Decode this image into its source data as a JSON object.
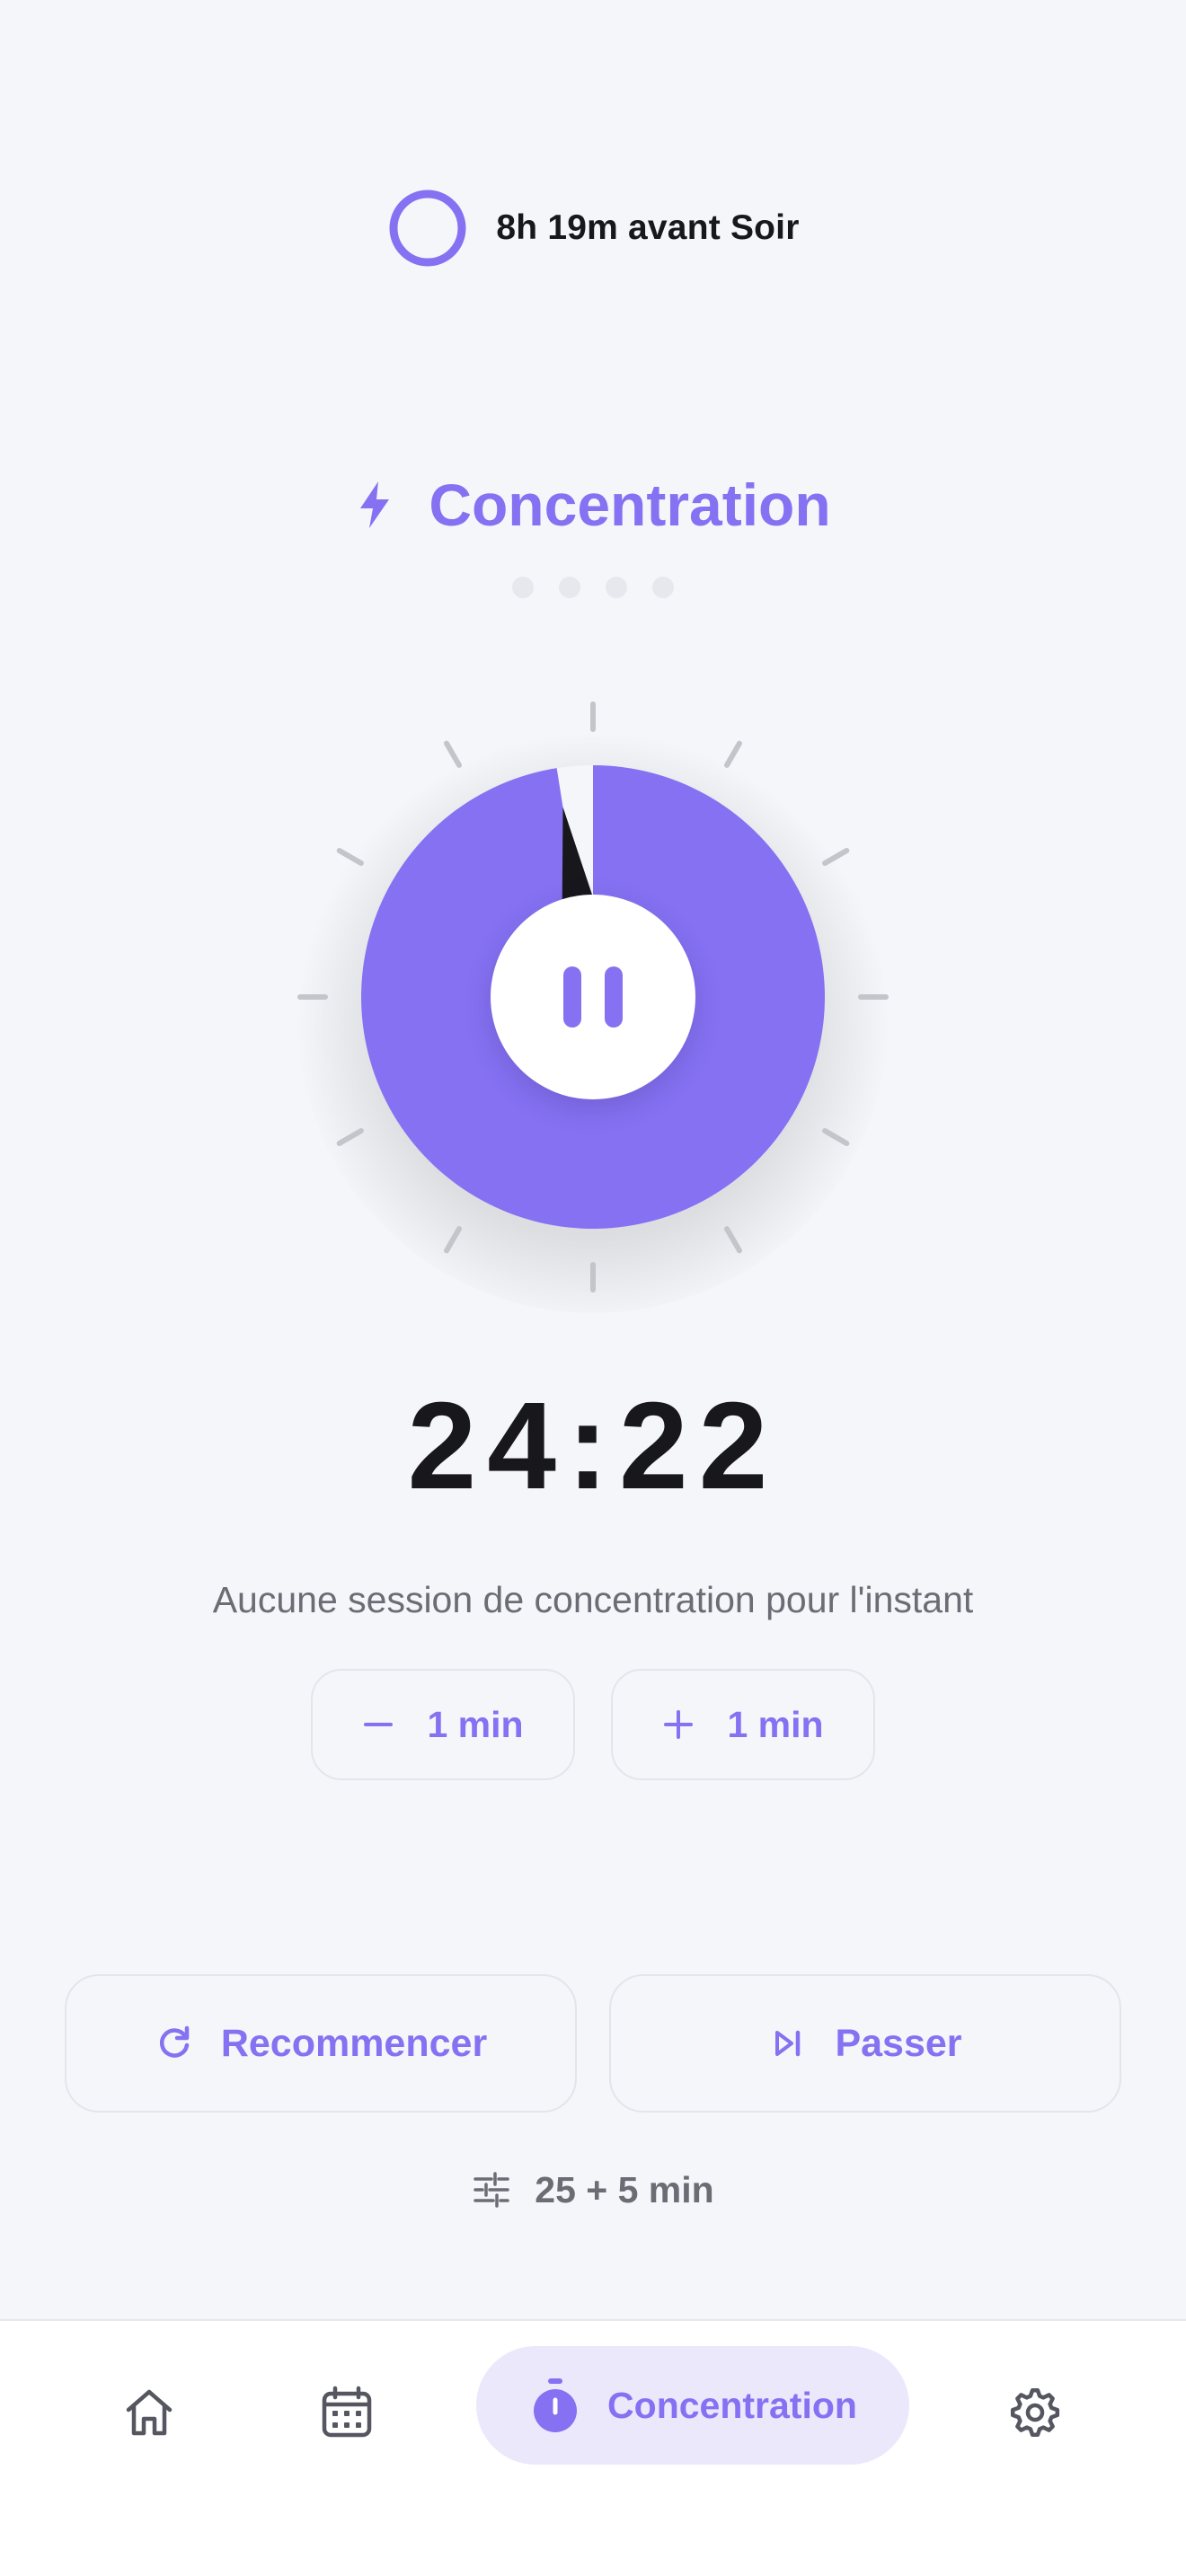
{
  "status": {
    "text": "8h 19m avant Soir"
  },
  "phase": {
    "title": "Concentration",
    "icon": "bolt-icon",
    "session_dots": 4
  },
  "timer": {
    "display": "24:22",
    "progress_fraction": 0.975,
    "controls": {
      "pause_icon": "pause-icon"
    }
  },
  "session": {
    "message": "Aucune session de concentration pour l'instant"
  },
  "adjust": {
    "minus_label": "1 min",
    "plus_label": "1 min"
  },
  "actions": {
    "restart_label": "Recommencer",
    "skip_label": "Passer"
  },
  "preset": {
    "label": "25 + 5 min"
  },
  "nav": {
    "items": [
      {
        "icon": "home-icon",
        "label": ""
      },
      {
        "icon": "calendar-icon",
        "label": ""
      },
      {
        "icon": "stopwatch-icon",
        "label": "Concentration",
        "active": true
      },
      {
        "icon": "gear-icon",
        "label": ""
      }
    ]
  },
  "colors": {
    "accent": "#8571f2",
    "accent_soft": "#ebe8fc",
    "background": "#f5f6fa",
    "text": "#17171c",
    "muted": "#6b6c74"
  }
}
